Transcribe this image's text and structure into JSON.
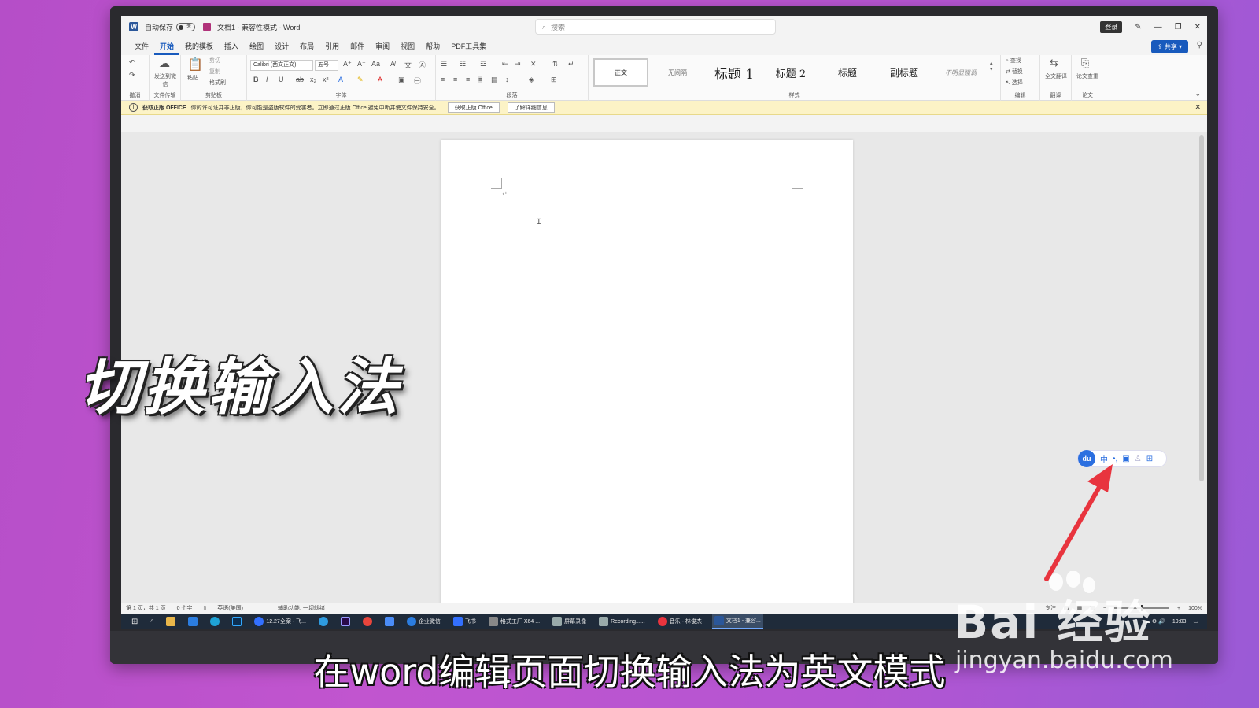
{
  "titlebar": {
    "autosave_label": "自动保存",
    "autosave_state": "关",
    "doc_title": "文档1 - 兼容性模式 - Word",
    "search_placeholder": "搜索",
    "login": "登录"
  },
  "menu": {
    "tabs": [
      "文件",
      "开始",
      "我的模板",
      "插入",
      "绘图",
      "设计",
      "布局",
      "引用",
      "邮件",
      "审阅",
      "视图",
      "帮助",
      "PDF工具集"
    ],
    "active_tab": "开始",
    "share": "共享"
  },
  "ribbon": {
    "groups": [
      "撤消",
      "文件传输",
      "剪贴板",
      "字体",
      "段落",
      "样式",
      "编辑",
      "翻译",
      "论文"
    ],
    "send_wechat": "发送到微信",
    "paste": "粘贴",
    "cut": "剪切",
    "copy": "复制",
    "format_painter": "格式刷",
    "font_name": "Calibri (西文正文)",
    "font_size": "五号",
    "styles": [
      "正文",
      "无间隔",
      "标题 1",
      "标题 2",
      "标题",
      "副标题",
      "不明显强调"
    ],
    "find": "查找",
    "replace": "替换",
    "select": "选择",
    "translate": "全文翻译",
    "paper": "论文查重"
  },
  "notice": {
    "title": "获取正版 OFFICE",
    "message": "你的许可证并非正版，你可能是盗版软件的受害者。立即通过正版 Office 避免中断并使文件保持安全。",
    "btn_get": "获取正版 Office",
    "btn_learn": "了解详细信息"
  },
  "ime": {
    "logo": "du",
    "mode": "中"
  },
  "statusbar": {
    "page": "第 1 页，共 1 页",
    "words": "0 个字",
    "language": "英语(美国)",
    "accessibility": "辅助功能: 一切就绪",
    "focus": "专注",
    "zoom": "100%"
  },
  "taskbar": {
    "items": [
      "12.27全案 - 飞...",
      "企业微信",
      "飞书",
      "格式工厂 X64 ...",
      "屏幕录像",
      "Recording......",
      "音乐 - 林俊杰",
      "文档1 - 兼容..."
    ],
    "clock": "19:03"
  },
  "overlay": {
    "caption": "切换输入法",
    "subtitle": "在word编辑页面切换输入法为英文模式",
    "watermark_brand": "Bai  经验",
    "watermark_url": "jingyan.baidu.com"
  },
  "colors": {
    "accent": "#185abd",
    "arrow": "#e8343e",
    "background": "#c155cf"
  }
}
